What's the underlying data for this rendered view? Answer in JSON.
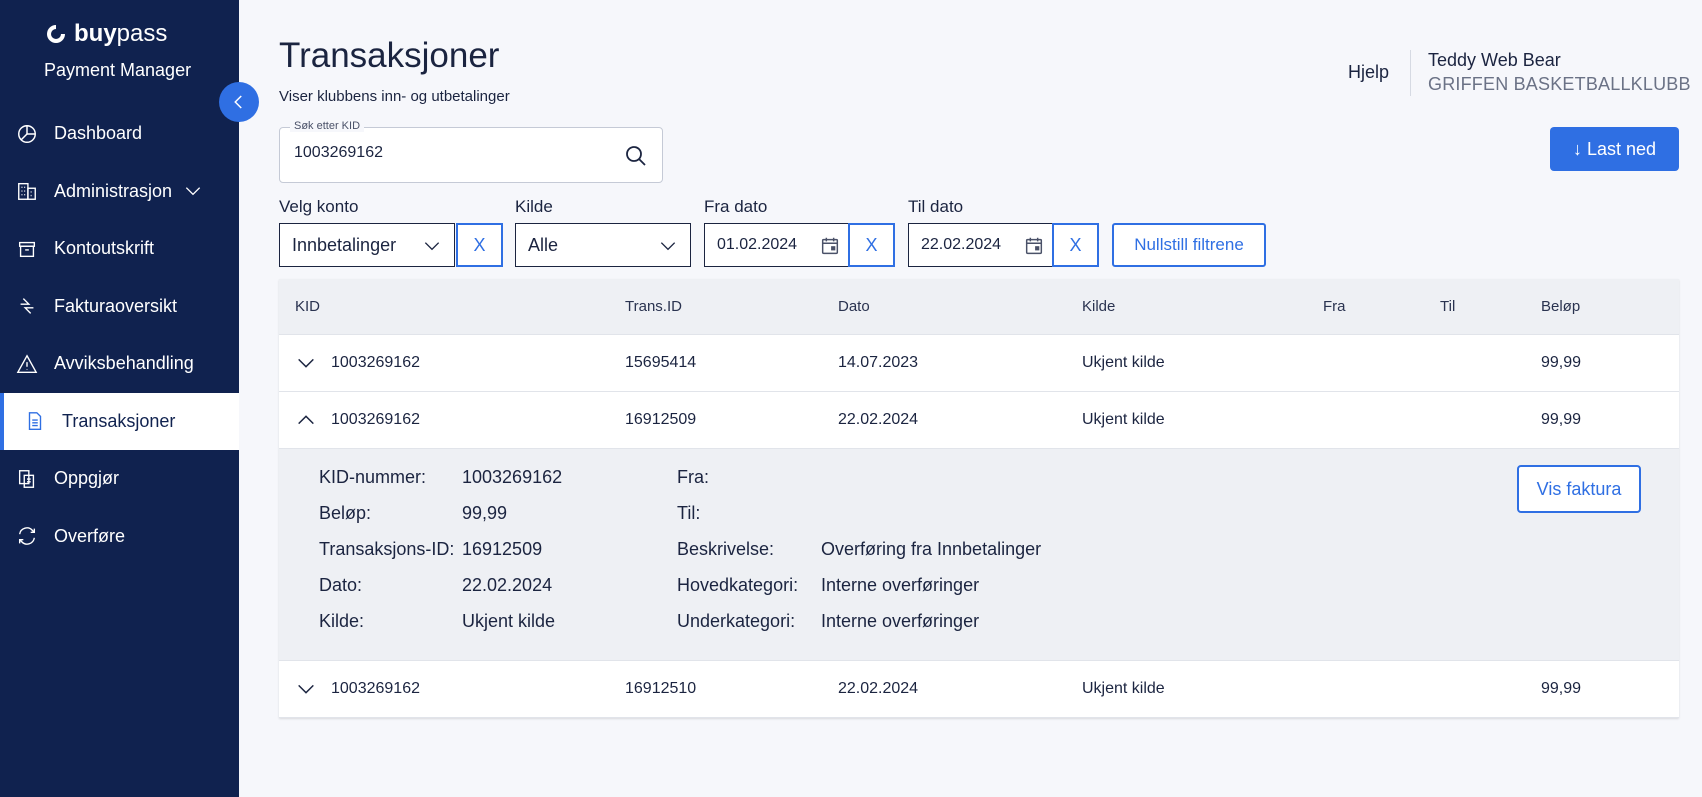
{
  "brand": {
    "name_bold": "buy",
    "name_rest": "pass",
    "subtitle": "Payment Manager"
  },
  "sidebar": {
    "items": [
      {
        "label": "Dashboard",
        "icon": "pie-chart-icon"
      },
      {
        "label": "Administrasjon",
        "icon": "building-icon"
      },
      {
        "label": "Kontoutskrift",
        "icon": "archive-icon"
      },
      {
        "label": "Fakturaoversikt",
        "icon": "transfer-arrows-icon"
      },
      {
        "label": "Avviksbehandling",
        "icon": "warning-icon"
      },
      {
        "label": "Transaksjoner",
        "icon": "document-icon",
        "active": true
      },
      {
        "label": "Oppgjør",
        "icon": "settlement-icon"
      },
      {
        "label": "Overføre",
        "icon": "refresh-arrows-icon"
      }
    ]
  },
  "header": {
    "title": "Transaksjoner",
    "subtitle": "Viser klubbens inn- og utbetalinger",
    "help": "Hjelp",
    "user_name": "Teddy Web Bear",
    "club_name": "GRIFFEN BASKETBALLKLUBB"
  },
  "search": {
    "legend": "Søk etter KID",
    "value": "1003269162"
  },
  "download_label": "↓ Last ned",
  "filters": {
    "account_label": "Velg konto",
    "account_value": "Innbetalinger",
    "source_label": "Kilde",
    "source_value": "Alle",
    "from_label": "Fra dato",
    "from_value": "01.02.2024",
    "to_label": "Til dato",
    "to_value": "22.02.2024",
    "clear": "X",
    "reset": "Nullstill filtrene"
  },
  "table": {
    "headers": [
      "KID",
      "Trans.ID",
      "Dato",
      "Kilde",
      "Fra",
      "Til",
      "Beløp"
    ],
    "rows": [
      {
        "kid": "1003269162",
        "trans_id": "15695414",
        "date": "14.07.2023",
        "source": "Ukjent kilde",
        "from": "",
        "to": "",
        "amount": "99,99"
      },
      {
        "kid": "1003269162",
        "trans_id": "16912509",
        "date": "22.02.2024",
        "source": "Ukjent kilde",
        "from": "",
        "to": "",
        "amount": "99,99"
      },
      {
        "kid": "1003269162",
        "trans_id": "16912510",
        "date": "22.02.2024",
        "source": "Ukjent kilde",
        "from": "",
        "to": "",
        "amount": "99,99"
      }
    ],
    "details": {
      "kid_label": "KID-nummer:",
      "kid_value": "1003269162",
      "amount_label": "Beløp:",
      "amount_value": "99,99",
      "trans_label": "Transaksjons-ID:",
      "trans_value": "16912509",
      "date_label": "Dato:",
      "date_value": "22.02.2024",
      "source_label": "Kilde:",
      "source_value": "Ukjent kilde",
      "from_label": "Fra:",
      "from_value": "",
      "to_label": "Til:",
      "to_value": "",
      "desc_label": "Beskrivelse:",
      "desc_value": "Overføring fra Innbetalinger",
      "main_cat_label": "Hovedkategori:",
      "main_cat_value": "Interne overføringer",
      "sub_cat_label": "Underkategori:",
      "sub_cat_value": "Interne overføringer",
      "invoice_button": "Vis faktura"
    }
  },
  "colors": {
    "sidebar": "#10224f",
    "accent": "#2f6fe3",
    "background": "#f6f7fb",
    "table_header": "#eef0f4"
  }
}
